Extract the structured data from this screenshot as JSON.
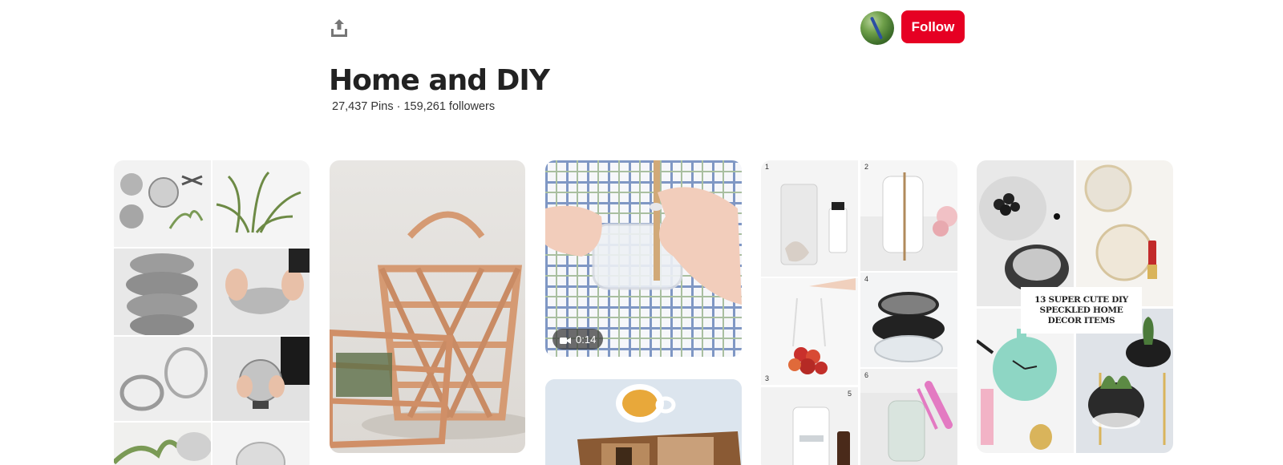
{
  "header": {
    "share_icon": "share-upload-icon",
    "avatar_alt": "board owner avatar",
    "follow_label": "Follow",
    "follow_color": "#e60023"
  },
  "board": {
    "title": "Home and DIY",
    "stats": "27,437 Pins · 159,261 followers"
  },
  "pins": [
    {
      "id": "wire-crafts",
      "kind": "collage"
    },
    {
      "id": "woven-baskets",
      "kind": "image"
    },
    {
      "id": "video-pin",
      "kind": "video",
      "duration": "0:14",
      "badge_icon": "video-camera-icon"
    },
    {
      "id": "tea-wood",
      "kind": "image"
    },
    {
      "id": "numbered-grid",
      "kind": "collage",
      "numbers": [
        "1",
        "2",
        "3",
        "4",
        "5",
        "6"
      ]
    },
    {
      "id": "speckled-decor",
      "kind": "collage",
      "overlay_text": "13 SUPER CUTE DIY SPECKLED HOME DECOR ITEMS"
    }
  ]
}
